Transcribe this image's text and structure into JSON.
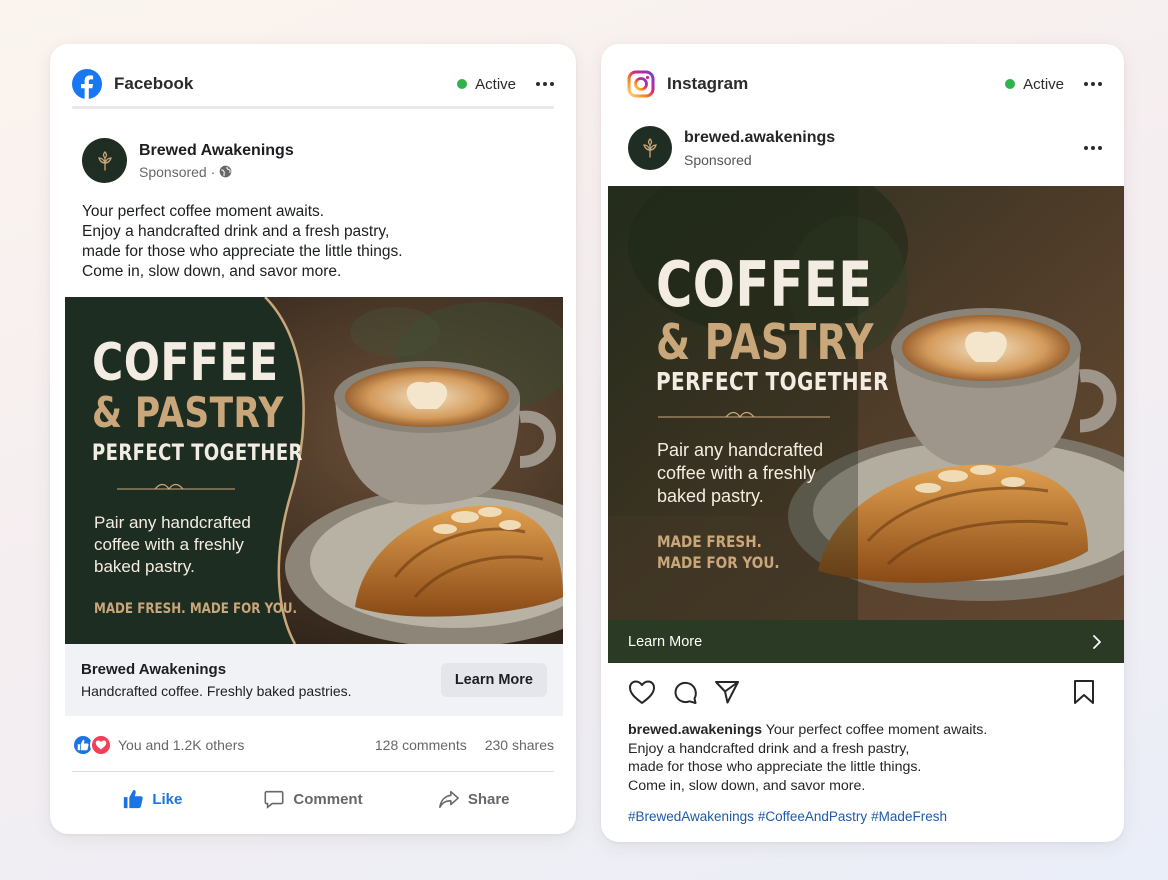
{
  "colors": {
    "facebook_blue": "#1877f2",
    "active_green": "#2fb34a",
    "forest_green": "#1e2d22",
    "gold_accent": "#c9a77a",
    "hashtag_blue": "#1e5aa8"
  },
  "facebook": {
    "platform_name": "Facebook",
    "status": "Active",
    "page_name": "Brewed Awakenings",
    "sponsored": "Sponsored ·",
    "post_lines": [
      "Your perfect coffee moment awaits.",
      "Enjoy a handcrafted drink and a fresh pastry,",
      "made for those who appreciate the little things.",
      "Come in, slow down, and savor more."
    ],
    "creative": {
      "headline_1": "COFFEE",
      "headline_2": "& PASTRY",
      "headline_3": "PERFECT TOGETHER",
      "body_lines": [
        "Pair any handcrafted",
        "coffee with a freshly",
        "baked pastry."
      ],
      "tagline": "MADE FRESH. MADE FOR YOU."
    },
    "link_title": "Brewed Awakenings",
    "link_subtitle": "Handcrafted coffee. Freshly baked pastries.",
    "cta": "Learn More",
    "reactions_text": "You and 1.2K others",
    "comments": "128 comments",
    "shares": "230 shares",
    "actions": {
      "like": "Like",
      "comment": "Comment",
      "share": "Share"
    }
  },
  "instagram": {
    "platform_name": "Instagram",
    "status": "Active",
    "handle": "brewed.awakenings",
    "sponsored": "Sponsored",
    "creative": {
      "headline_1": "COFFEE",
      "headline_2": "& PASTRY",
      "headline_3": "PERFECT TOGETHER",
      "body_lines": [
        "Pair any handcrafted",
        "coffee with a freshly",
        "baked pastry."
      ],
      "tagline_1": "MADE FRESH.",
      "tagline_2": "MADE FOR YOU."
    },
    "cta": "Learn More",
    "caption_handle": "brewed.awakenings",
    "caption_lines": [
      "Your perfect coffee moment awaits.",
      "Enjoy a handcrafted drink and a fresh pastry,",
      "made for those who appreciate the little things.",
      "Come in, slow down, and savor more."
    ],
    "hashtags": [
      "#BrewedAwakenings",
      "#CoffeeAndPastry",
      "#MadeFresh"
    ]
  }
}
